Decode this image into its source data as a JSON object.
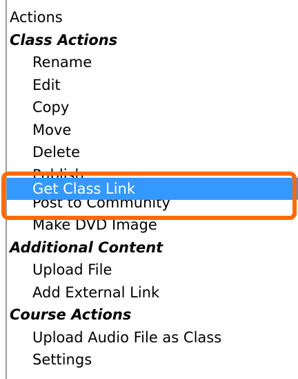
{
  "menu": {
    "header": "Actions",
    "groups": {
      "class_actions": {
        "label": "Class Actions",
        "items": {
          "rename": "Rename",
          "edit": "Edit",
          "copy": "Copy",
          "move": "Move",
          "delete": "Delete",
          "publish": "Publish",
          "get_class_link": "Get Class Link",
          "post_to_community": "Post to Community",
          "make_dvd_image": "Make DVD Image"
        }
      },
      "additional_content": {
        "label": "Additional Content",
        "items": {
          "upload_file": "Upload File",
          "add_external_link": "Add External Link"
        }
      },
      "course_actions": {
        "label": "Course Actions",
        "items": {
          "upload_audio_file_as_class": "Upload Audio File as Class",
          "settings": "Settings"
        }
      }
    },
    "selected_item": "Get Class Link"
  },
  "colors": {
    "selection_background": "#3399ff",
    "selection_text": "#ffffff",
    "callout_border": "#ff6a00",
    "listbox_border": "#9a9a9a"
  }
}
